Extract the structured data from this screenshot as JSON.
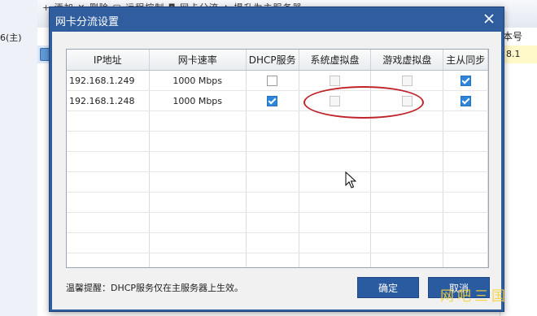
{
  "background": {
    "tree_node_label": "6(主)",
    "toolbar_text": "+ 添加  ✕ 删除  ▢ 远程控制  ◘ 网卡分流  ▲ 提升为主服务器",
    "version_column_header": "本号",
    "version_cell_value": "8.1"
  },
  "dialog": {
    "title": "网卡分流设置",
    "table": {
      "headers": {
        "ip": "IP地址",
        "speed": "网卡速率",
        "dhcp": "DHCP服务",
        "sys_vdisk": "系统虚拟盘",
        "game_vdisk": "游戏虚拟盘",
        "sync": "主从同步"
      },
      "rows": [
        {
          "ip": "192.168.1.249",
          "speed": "1000 Mbps",
          "dhcp": false,
          "sys_vdisk": false,
          "game_vdisk": false,
          "sync": true
        },
        {
          "ip": "192.168.1.248",
          "speed": "1000 Mbps",
          "dhcp": true,
          "sys_vdisk": false,
          "game_vdisk": false,
          "sync": true
        }
      ]
    },
    "tip": "温馨提醒：DHCP服务仅在主服务器上生效。",
    "ok_label": "确定",
    "cancel_label": "取消"
  },
  "watermark": "网吧三国",
  "colors": {
    "titlebar": "#2f5d9e",
    "button": "#2a5aa0",
    "checkbox_checked": "#2e86d9",
    "highlight": "#c0242b"
  }
}
